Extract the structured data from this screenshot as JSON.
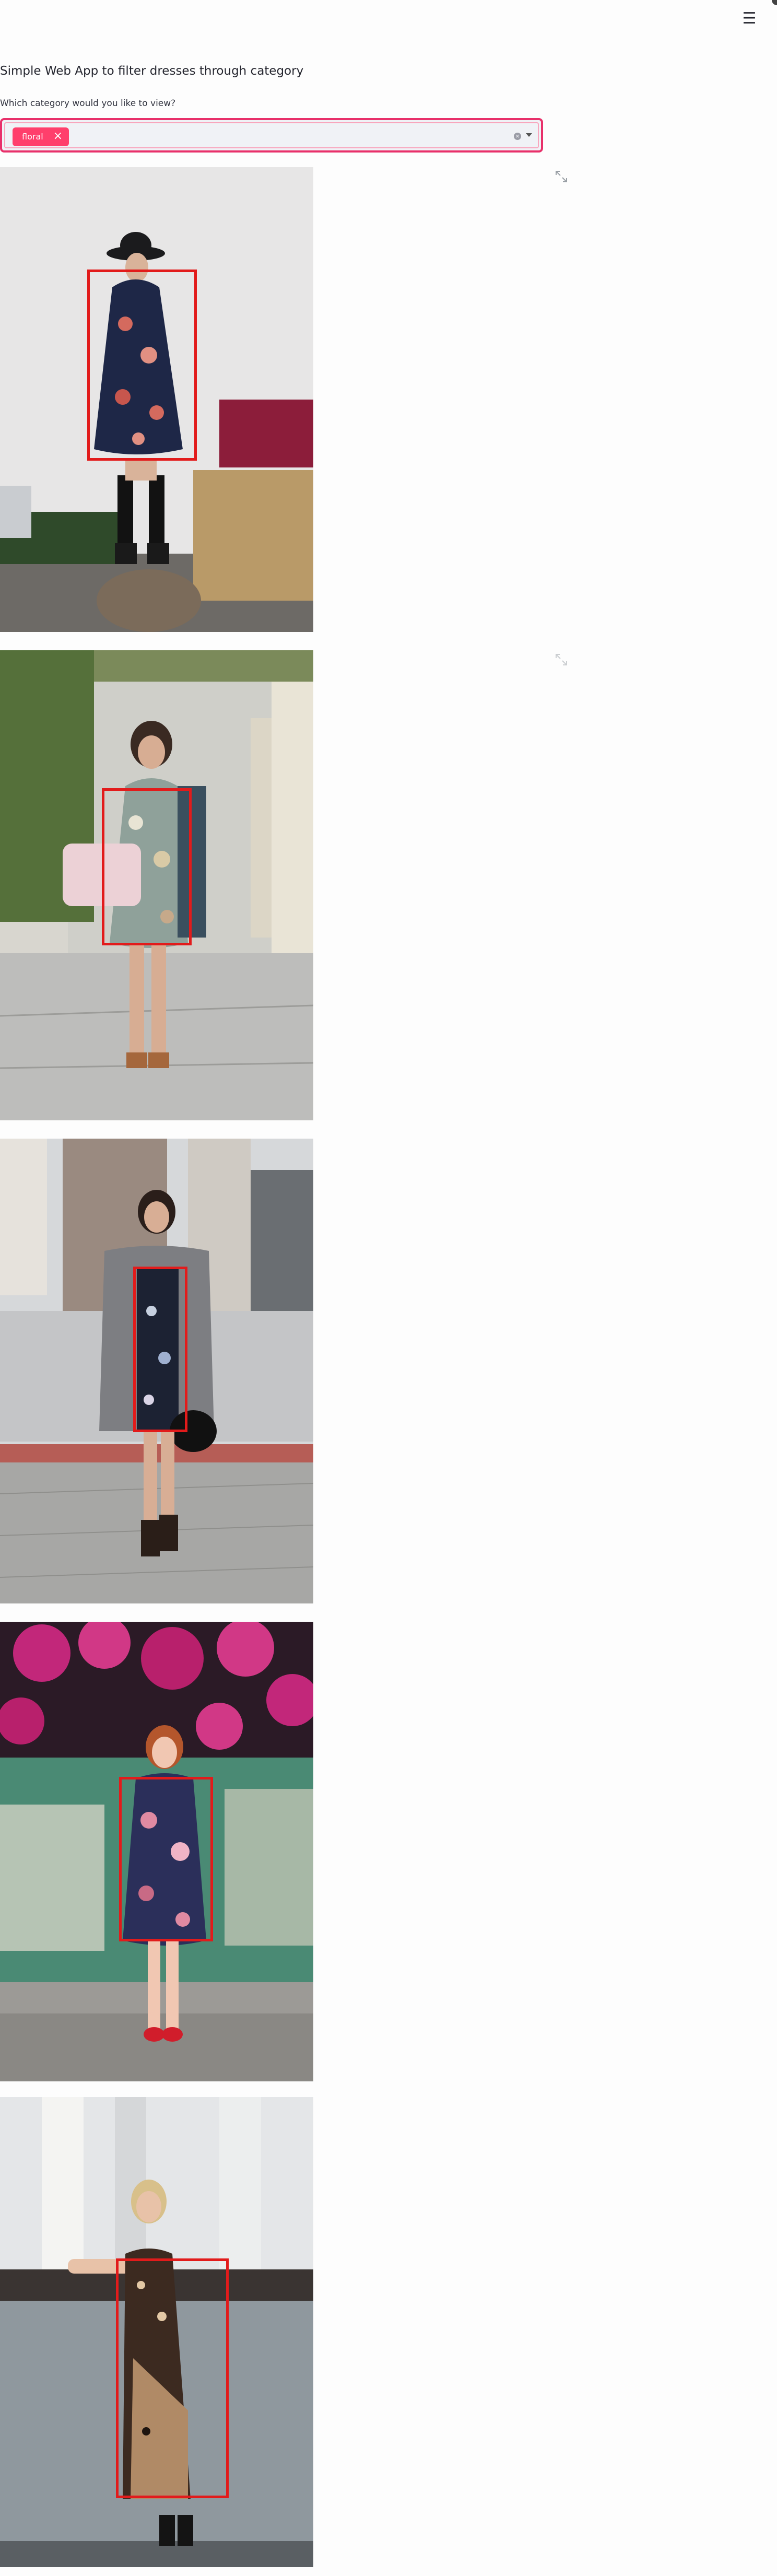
{
  "app": {
    "title": "Simple Web App to filter dresses through category",
    "menu_icon": "hamburger-icon"
  },
  "filter": {
    "label": "Which category would you like to view?",
    "selected": [
      {
        "label": "floral",
        "remove_symbol": "×"
      }
    ],
    "clear_icon": "clear-icon",
    "dropdown_icon": "chevron-down-icon",
    "accent_color": "#ff3f6c"
  },
  "results": {
    "bbox_color": "#e21b1b",
    "images": [
      {
        "alt": "woman in floral dress and wide-brim hat"
      },
      {
        "alt": "woman in floral mini dress with pink handbag"
      },
      {
        "alt": "woman in floral dress and grey fringe jacket"
      },
      {
        "alt": "woman in navy floral dress under bougainvillea"
      },
      {
        "alt": "woman in patchwork floral maxi dress"
      }
    ]
  }
}
